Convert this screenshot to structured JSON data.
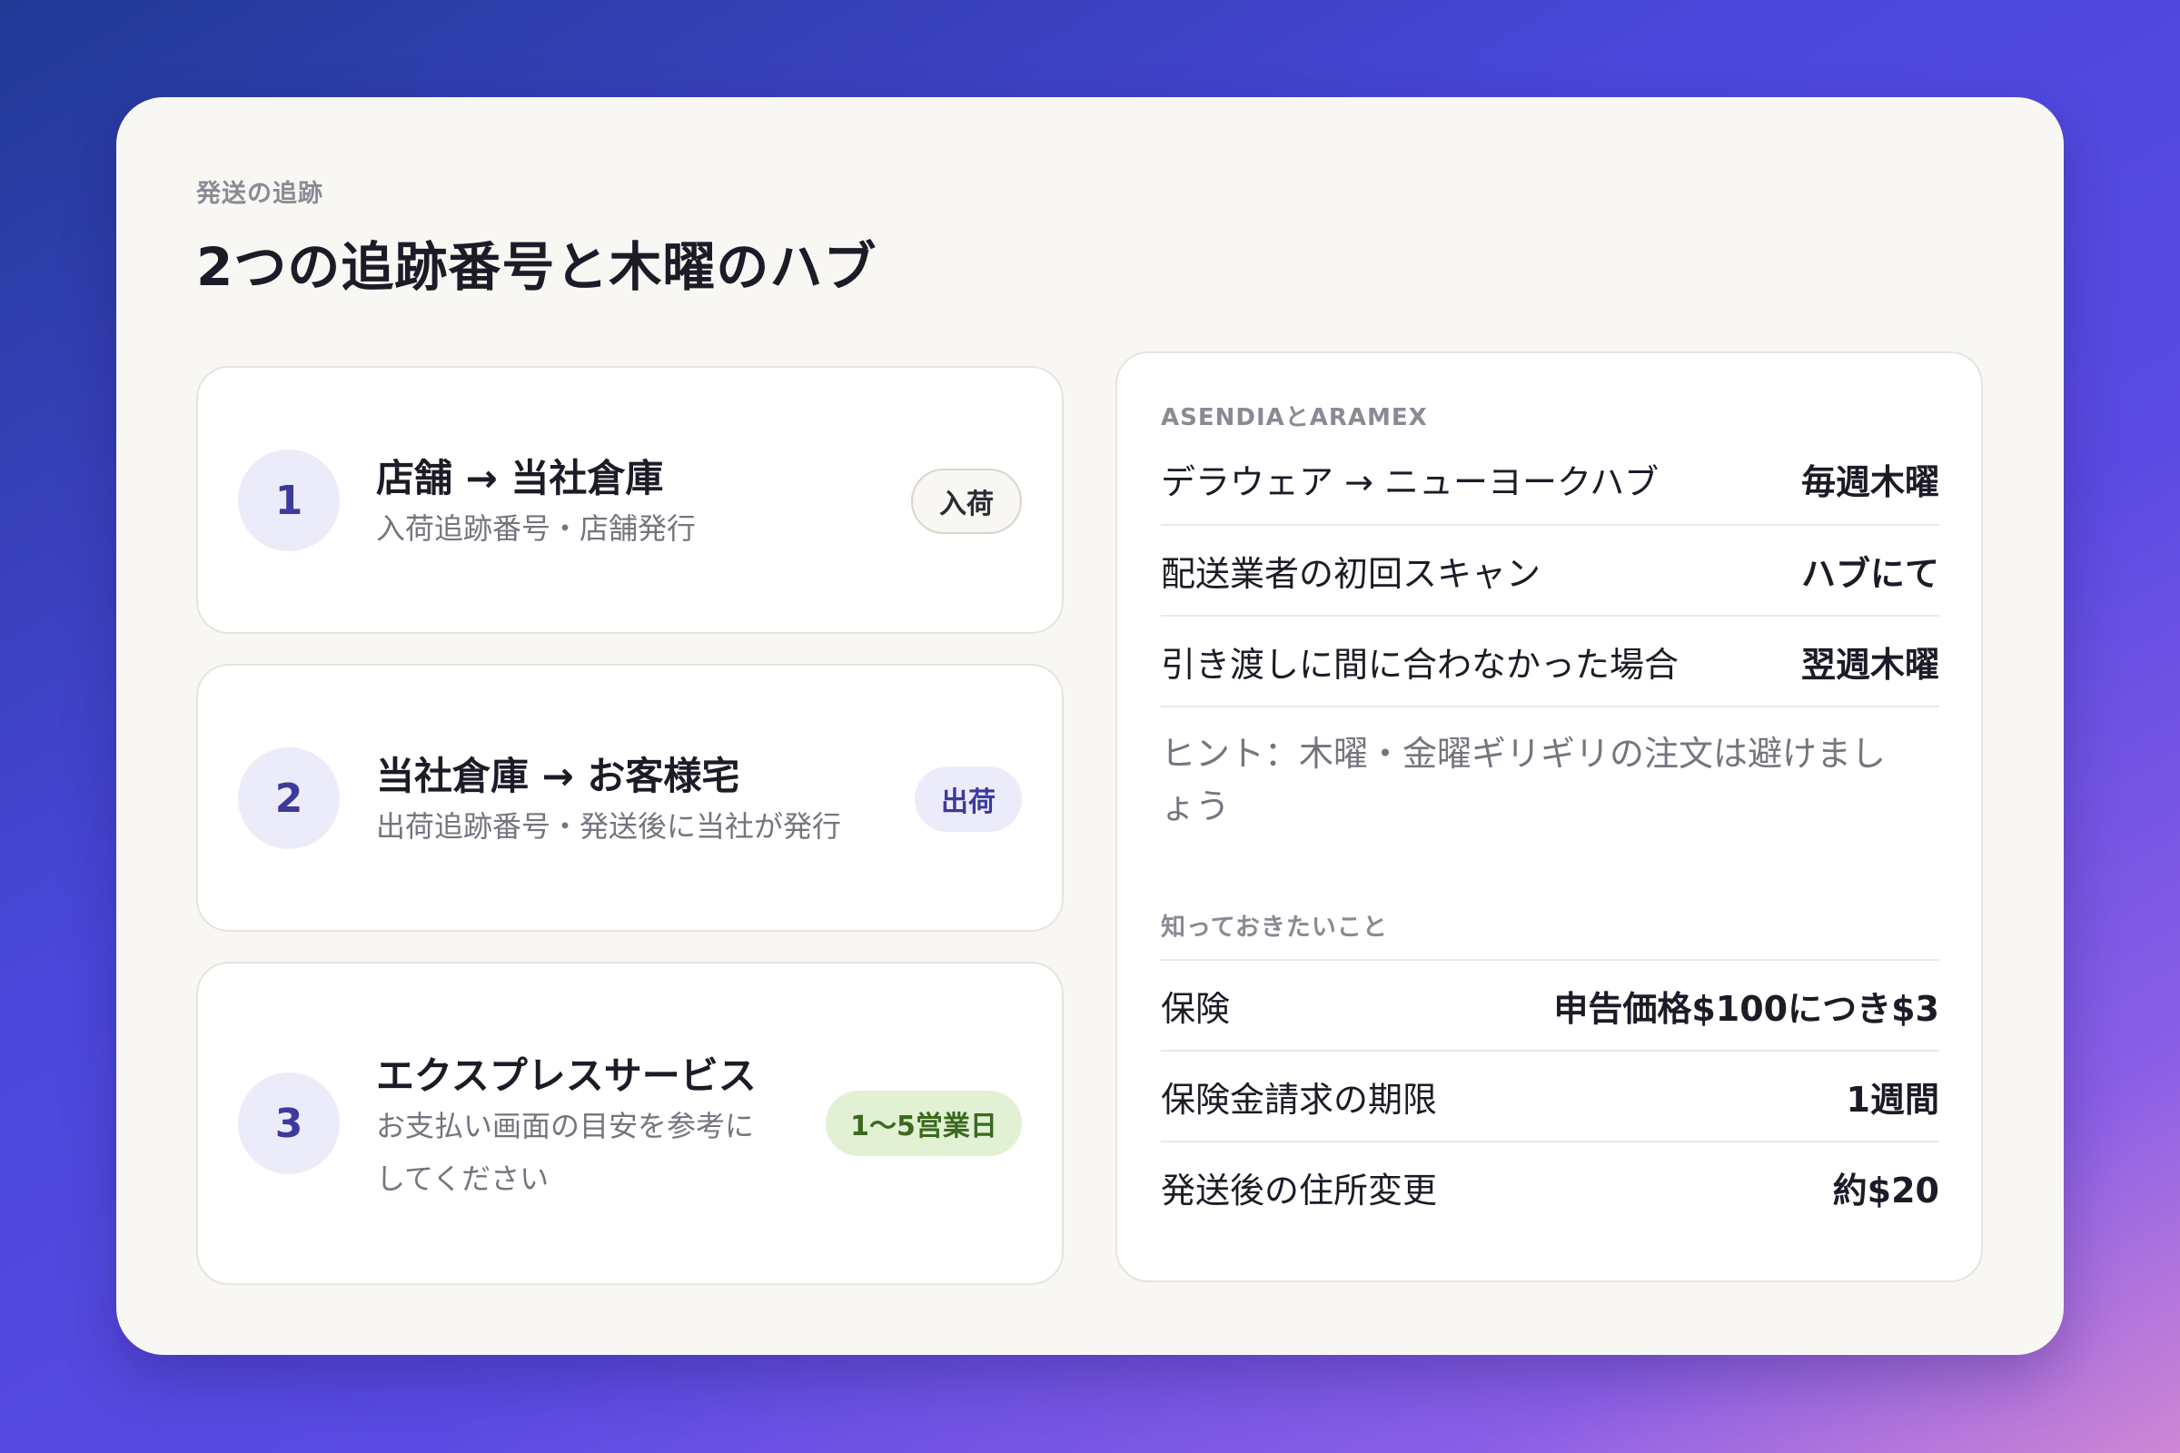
{
  "header": {
    "eyebrow": "発送の追跡",
    "title": "2つの追跡番号と木曜のハブ"
  },
  "steps": [
    {
      "number": "1",
      "title": "店舗 → 当社倉庫",
      "subtitle": "入荷追跡番号・店舗発行",
      "badge": "入荷"
    },
    {
      "number": "2",
      "title": "当社倉庫 → お客様宅",
      "subtitle": "出荷追跡番号・発送後に当社が発行",
      "badge": "出荷"
    },
    {
      "number": "3",
      "title": "エクスプレスサービス",
      "subtitle_line1": "お支払い画面の目安を参考に",
      "subtitle_line2": "してください",
      "badge": "1〜5営業日"
    }
  ],
  "carrier": {
    "heading": "ASENDIAとARAMEX",
    "rows": [
      {
        "label": "デラウェア → ニューヨークハブ",
        "value": "毎週木曜"
      },
      {
        "label": "配送業者の初回スキャン",
        "value": "ハブにて"
      },
      {
        "label": "引き渡しに間に合わなかった場合",
        "value": "翌週木曜"
      }
    ],
    "hint_line1": "ヒント：木曜・金曜ギリギリの注文は避けまし",
    "hint_line2": "ょう"
  },
  "know": {
    "heading": "知っておきたいこと",
    "rows": [
      {
        "label": "保険",
        "value": "申告価格$100につき$3"
      },
      {
        "label": "保険金請求の期限",
        "value": "1週間"
      },
      {
        "label": "発送後の住所変更",
        "value": "約$20"
      }
    ]
  },
  "colors": {
    "panel": "#f8f7f3",
    "accent_purple": "#3c3a9a",
    "badge_purple_bg": "#ecebfa",
    "badge_green_bg": "#e2f0d4",
    "badge_green_text": "#3a6a1e"
  }
}
